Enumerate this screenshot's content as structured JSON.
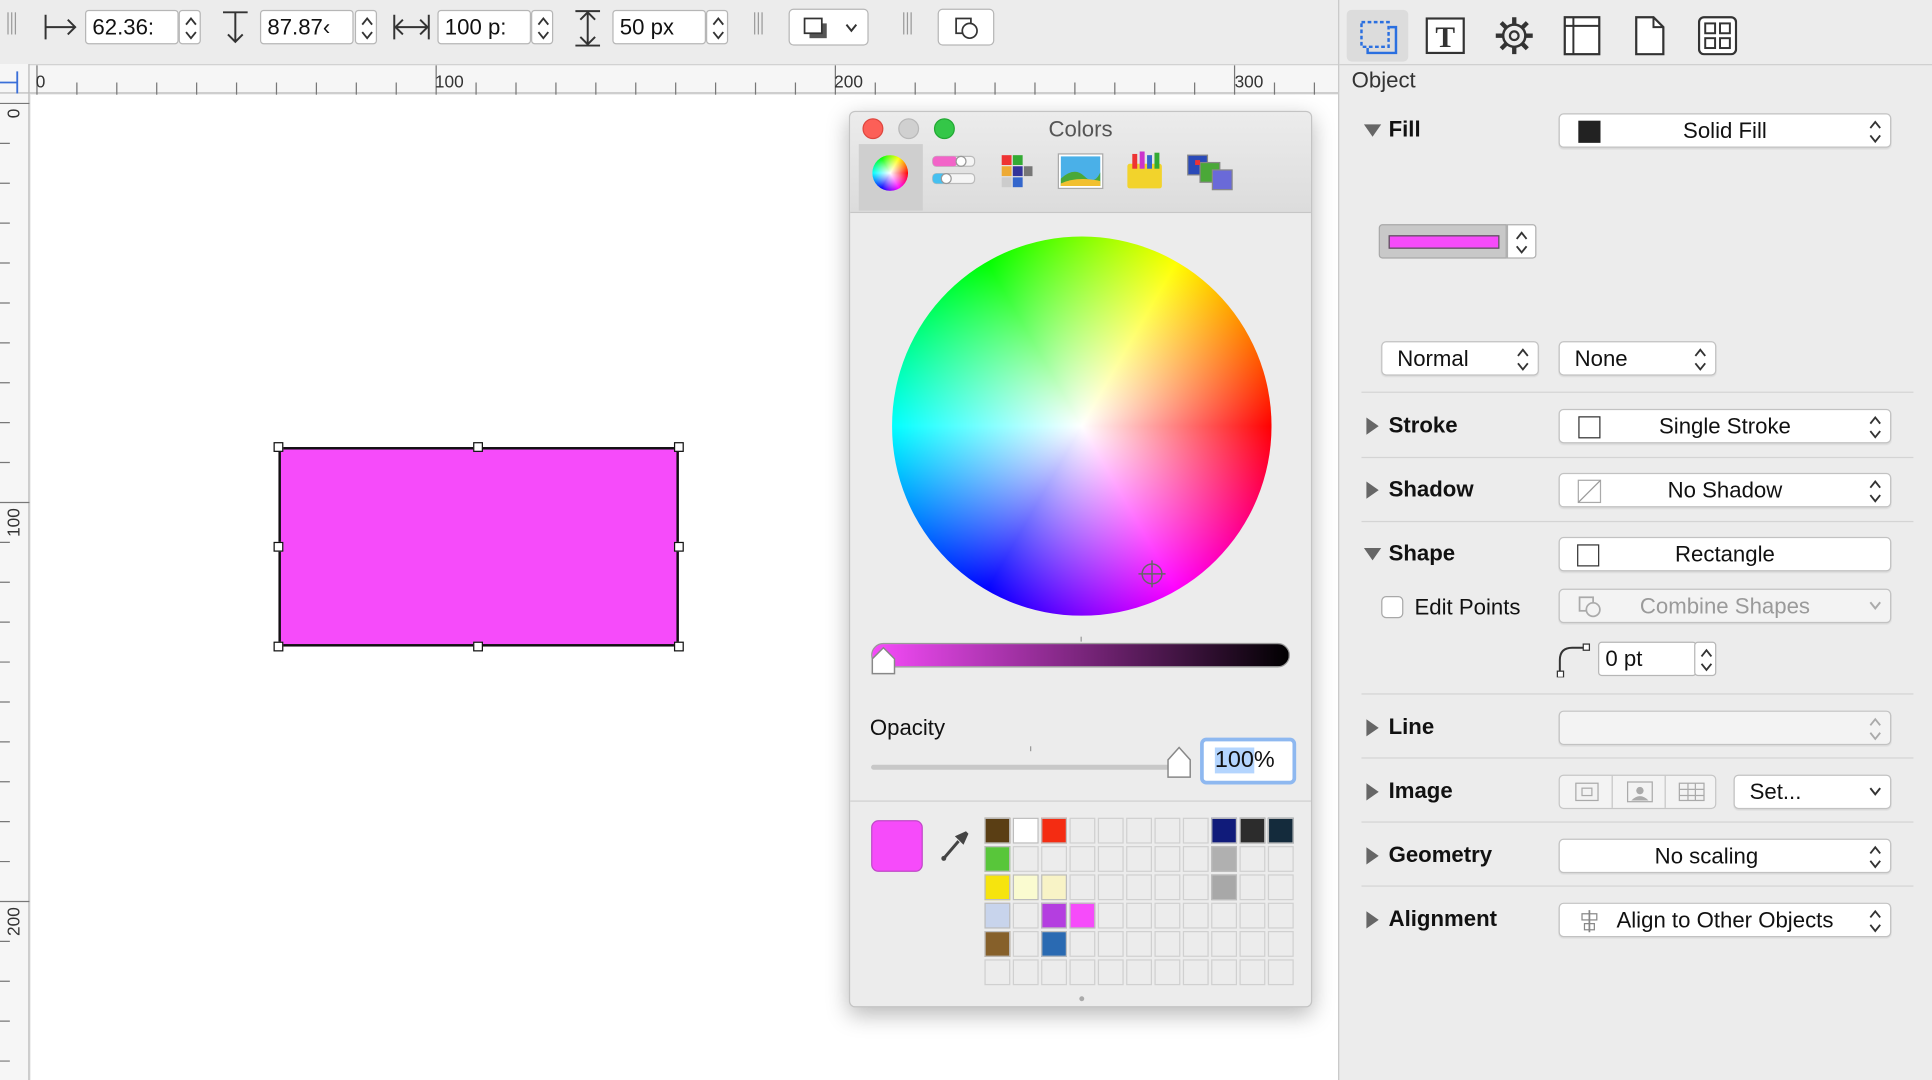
{
  "toolbar": {
    "x_value": "62.36:",
    "y_value": "87.87‹",
    "width_value": "100 p:",
    "height_value": "50 px"
  },
  "rulers": {
    "h_labels": [
      "0",
      "100",
      "200",
      "300"
    ],
    "v_labels": [
      "0",
      "100",
      "200"
    ]
  },
  "colors_panel": {
    "title": "Colors",
    "opacity_label": "Opacity",
    "opacity_value": "100",
    "opacity_suffix": "%",
    "current_color": "#f64bfa",
    "swatches": [
      "#5a3e14",
      "#ffffff",
      "#f42c12",
      "",
      "",
      "",
      "",
      "",
      "#101b7a",
      "#2c2c2c",
      "#142b3c",
      "#58c63a",
      "",
      "",
      "",
      "",
      "",
      "",
      "",
      "#b0b0b0",
      "",
      "",
      "#f6e40e",
      "#fafbd0",
      "#f8f3c6",
      "",
      "",
      "",
      "",
      "",
      "#a8a8a8",
      "",
      "",
      "#c8d4ec",
      "",
      "#b43ee0",
      "#f64bfa",
      "",
      "",
      "",
      "",
      "",
      "",
      "",
      "#86602a",
      "",
      "#2a6ab2",
      "",
      "",
      "",
      "",
      "",
      "",
      "",
      "",
      "",
      "",
      "",
      "",
      "",
      "",
      "",
      "",
      "",
      "",
      ""
    ]
  },
  "inspector": {
    "header": "Object",
    "fill_label": "Fill",
    "fill_type": "Solid Fill",
    "fill_color": "#f64bfa",
    "blend_mode": "Normal",
    "blend_secondary": "None",
    "stroke_label": "Stroke",
    "stroke_value": "Single Stroke",
    "shadow_label": "Shadow",
    "shadow_value": "No Shadow",
    "shape_label": "Shape",
    "shape_value": "Rectangle",
    "edit_points_label": "Edit Points",
    "combine_shapes_label": "Combine Shapes",
    "corner_radius_value": "0 pt",
    "line_label": "Line",
    "image_label": "Image",
    "image_set_label": "Set...",
    "geometry_label": "Geometry",
    "geometry_value": "No scaling",
    "alignment_label": "Alignment",
    "alignment_value": "Align to Other Objects"
  }
}
